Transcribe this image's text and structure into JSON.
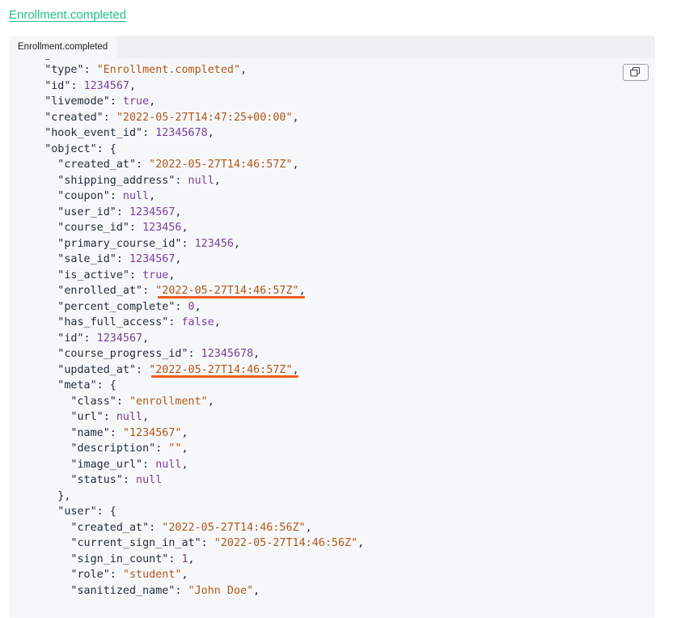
{
  "page": {
    "title": "Enrollment.completed"
  },
  "panel": {
    "tab_label": "Enrollment.completed",
    "copy_icon": "copy-icon"
  },
  "code_lines": [
    {
      "indent": 4,
      "parts": [
        {
          "t": "k",
          "v": "\"type\""
        },
        {
          "t": "p",
          "v": ": "
        },
        {
          "t": "s",
          "v": "\"Enrollment.completed\""
        },
        {
          "t": "p",
          "v": ","
        }
      ]
    },
    {
      "indent": 4,
      "parts": [
        {
          "t": "k",
          "v": "\"id\""
        },
        {
          "t": "p",
          "v": ": "
        },
        {
          "t": "n",
          "v": "1234567"
        },
        {
          "t": "p",
          "v": ","
        }
      ]
    },
    {
      "indent": 4,
      "parts": [
        {
          "t": "k",
          "v": "\"livemode\""
        },
        {
          "t": "p",
          "v": ": "
        },
        {
          "t": "b",
          "v": "true"
        },
        {
          "t": "p",
          "v": ","
        }
      ]
    },
    {
      "indent": 4,
      "parts": [
        {
          "t": "k",
          "v": "\"created\""
        },
        {
          "t": "p",
          "v": ": "
        },
        {
          "t": "s",
          "v": "\"2022-05-27T14:47:25+00:00\""
        },
        {
          "t": "p",
          "v": ","
        }
      ]
    },
    {
      "indent": 4,
      "parts": [
        {
          "t": "k",
          "v": "\"hook_event_id\""
        },
        {
          "t": "p",
          "v": ": "
        },
        {
          "t": "n",
          "v": "12345678"
        },
        {
          "t": "p",
          "v": ","
        }
      ]
    },
    {
      "indent": 4,
      "parts": [
        {
          "t": "k",
          "v": "\"object\""
        },
        {
          "t": "p",
          "v": ": {"
        }
      ]
    },
    {
      "indent": 6,
      "parts": [
        {
          "t": "k",
          "v": "\"created_at\""
        },
        {
          "t": "p",
          "v": ": "
        },
        {
          "t": "s",
          "v": "\"2022-05-27T14:46:57Z\""
        },
        {
          "t": "p",
          "v": ","
        }
      ]
    },
    {
      "indent": 6,
      "parts": [
        {
          "t": "k",
          "v": "\"shipping_address\""
        },
        {
          "t": "p",
          "v": ": "
        },
        {
          "t": "b",
          "v": "null"
        },
        {
          "t": "p",
          "v": ","
        }
      ]
    },
    {
      "indent": 6,
      "parts": [
        {
          "t": "k",
          "v": "\"coupon\""
        },
        {
          "t": "p",
          "v": ": "
        },
        {
          "t": "b",
          "v": "null"
        },
        {
          "t": "p",
          "v": ","
        }
      ]
    },
    {
      "indent": 6,
      "parts": [
        {
          "t": "k",
          "v": "\"user_id\""
        },
        {
          "t": "p",
          "v": ": "
        },
        {
          "t": "n",
          "v": "1234567"
        },
        {
          "t": "p",
          "v": ","
        }
      ]
    },
    {
      "indent": 6,
      "parts": [
        {
          "t": "k",
          "v": "\"course_id\""
        },
        {
          "t": "p",
          "v": ": "
        },
        {
          "t": "n",
          "v": "123456"
        },
        {
          "t": "p",
          "v": ","
        }
      ]
    },
    {
      "indent": 6,
      "parts": [
        {
          "t": "k",
          "v": "\"primary_course_id\""
        },
        {
          "t": "p",
          "v": ": "
        },
        {
          "t": "n",
          "v": "123456"
        },
        {
          "t": "p",
          "v": ","
        }
      ]
    },
    {
      "indent": 6,
      "parts": [
        {
          "t": "k",
          "v": "\"sale_id\""
        },
        {
          "t": "p",
          "v": ": "
        },
        {
          "t": "n",
          "v": "1234567"
        },
        {
          "t": "p",
          "v": ","
        }
      ]
    },
    {
      "indent": 6,
      "parts": [
        {
          "t": "k",
          "v": "\"is_active\""
        },
        {
          "t": "p",
          "v": ": "
        },
        {
          "t": "b",
          "v": "true"
        },
        {
          "t": "p",
          "v": ","
        }
      ]
    },
    {
      "indent": 6,
      "parts": [
        {
          "t": "k",
          "v": "\"enrolled_at\""
        },
        {
          "t": "p",
          "v": ": "
        },
        {
          "t": "s",
          "v": "\"2022-05-27T14:46:57Z\"",
          "hl": true
        },
        {
          "t": "p",
          "v": ","
        }
      ]
    },
    {
      "indent": 6,
      "parts": [
        {
          "t": "k",
          "v": "\"percent_complete\""
        },
        {
          "t": "p",
          "v": ": "
        },
        {
          "t": "n",
          "v": "0"
        },
        {
          "t": "p",
          "v": ","
        }
      ]
    },
    {
      "indent": 6,
      "parts": [
        {
          "t": "k",
          "v": "\"has_full_access\""
        },
        {
          "t": "p",
          "v": ": "
        },
        {
          "t": "b",
          "v": "false"
        },
        {
          "t": "p",
          "v": ","
        }
      ]
    },
    {
      "indent": 6,
      "parts": [
        {
          "t": "k",
          "v": "\"id\""
        },
        {
          "t": "p",
          "v": ": "
        },
        {
          "t": "n",
          "v": "1234567"
        },
        {
          "t": "p",
          "v": ","
        }
      ]
    },
    {
      "indent": 6,
      "parts": [
        {
          "t": "k",
          "v": "\"course_progress_id\""
        },
        {
          "t": "p",
          "v": ": "
        },
        {
          "t": "n",
          "v": "12345678"
        },
        {
          "t": "p",
          "v": ","
        }
      ]
    },
    {
      "indent": 6,
      "parts": [
        {
          "t": "k",
          "v": "\"updated_at\""
        },
        {
          "t": "p",
          "v": ": "
        },
        {
          "t": "s",
          "v": "\"2022-05-27T14:46:57Z\"",
          "hl": true
        },
        {
          "t": "p",
          "v": ","
        }
      ]
    },
    {
      "indent": 6,
      "parts": [
        {
          "t": "k",
          "v": "\"meta\""
        },
        {
          "t": "p",
          "v": ": {"
        }
      ]
    },
    {
      "indent": 8,
      "parts": [
        {
          "t": "k",
          "v": "\"class\""
        },
        {
          "t": "p",
          "v": ": "
        },
        {
          "t": "s",
          "v": "\"enrollment\""
        },
        {
          "t": "p",
          "v": ","
        }
      ]
    },
    {
      "indent": 8,
      "parts": [
        {
          "t": "k",
          "v": "\"url\""
        },
        {
          "t": "p",
          "v": ": "
        },
        {
          "t": "b",
          "v": "null"
        },
        {
          "t": "p",
          "v": ","
        }
      ]
    },
    {
      "indent": 8,
      "parts": [
        {
          "t": "k",
          "v": "\"name\""
        },
        {
          "t": "p",
          "v": ": "
        },
        {
          "t": "s",
          "v": "\"1234567\""
        },
        {
          "t": "p",
          "v": ","
        }
      ]
    },
    {
      "indent": 8,
      "parts": [
        {
          "t": "k",
          "v": "\"description\""
        },
        {
          "t": "p",
          "v": ": "
        },
        {
          "t": "s",
          "v": "\"\""
        },
        {
          "t": "p",
          "v": ","
        }
      ]
    },
    {
      "indent": 8,
      "parts": [
        {
          "t": "k",
          "v": "\"image_url\""
        },
        {
          "t": "p",
          "v": ": "
        },
        {
          "t": "b",
          "v": "null"
        },
        {
          "t": "p",
          "v": ","
        }
      ]
    },
    {
      "indent": 8,
      "parts": [
        {
          "t": "k",
          "v": "\"status\""
        },
        {
          "t": "p",
          "v": ": "
        },
        {
          "t": "b",
          "v": "null"
        }
      ]
    },
    {
      "indent": 6,
      "parts": [
        {
          "t": "p",
          "v": "},"
        }
      ]
    },
    {
      "indent": 6,
      "parts": [
        {
          "t": "k",
          "v": "\"user\""
        },
        {
          "t": "p",
          "v": ": {"
        }
      ]
    },
    {
      "indent": 8,
      "parts": [
        {
          "t": "k",
          "v": "\"created_at\""
        },
        {
          "t": "p",
          "v": ": "
        },
        {
          "t": "s",
          "v": "\"2022-05-27T14:46:56Z\""
        },
        {
          "t": "p",
          "v": ","
        }
      ]
    },
    {
      "indent": 8,
      "parts": [
        {
          "t": "k",
          "v": "\"current_sign_in_at\""
        },
        {
          "t": "p",
          "v": ": "
        },
        {
          "t": "s",
          "v": "\"2022-05-27T14:46:56Z\""
        },
        {
          "t": "p",
          "v": ","
        }
      ]
    },
    {
      "indent": 8,
      "parts": [
        {
          "t": "k",
          "v": "\"sign_in_count\""
        },
        {
          "t": "p",
          "v": ": "
        },
        {
          "t": "n",
          "v": "1"
        },
        {
          "t": "p",
          "v": ","
        }
      ]
    },
    {
      "indent": 8,
      "parts": [
        {
          "t": "k",
          "v": "\"role\""
        },
        {
          "t": "p",
          "v": ": "
        },
        {
          "t": "s",
          "v": "\"student\""
        },
        {
          "t": "p",
          "v": ","
        }
      ]
    },
    {
      "indent": 8,
      "parts": [
        {
          "t": "k",
          "v": "\"sanitized_name\""
        },
        {
          "t": "p",
          "v": ": "
        },
        {
          "t": "s",
          "v": "\"John Doe\""
        },
        {
          "t": "p",
          "v": ","
        }
      ]
    }
  ],
  "colors": {
    "link": "#1fbf8f",
    "highlight": "#ef5c1a",
    "string": "#b0581a",
    "number": "#7a3e9d"
  }
}
